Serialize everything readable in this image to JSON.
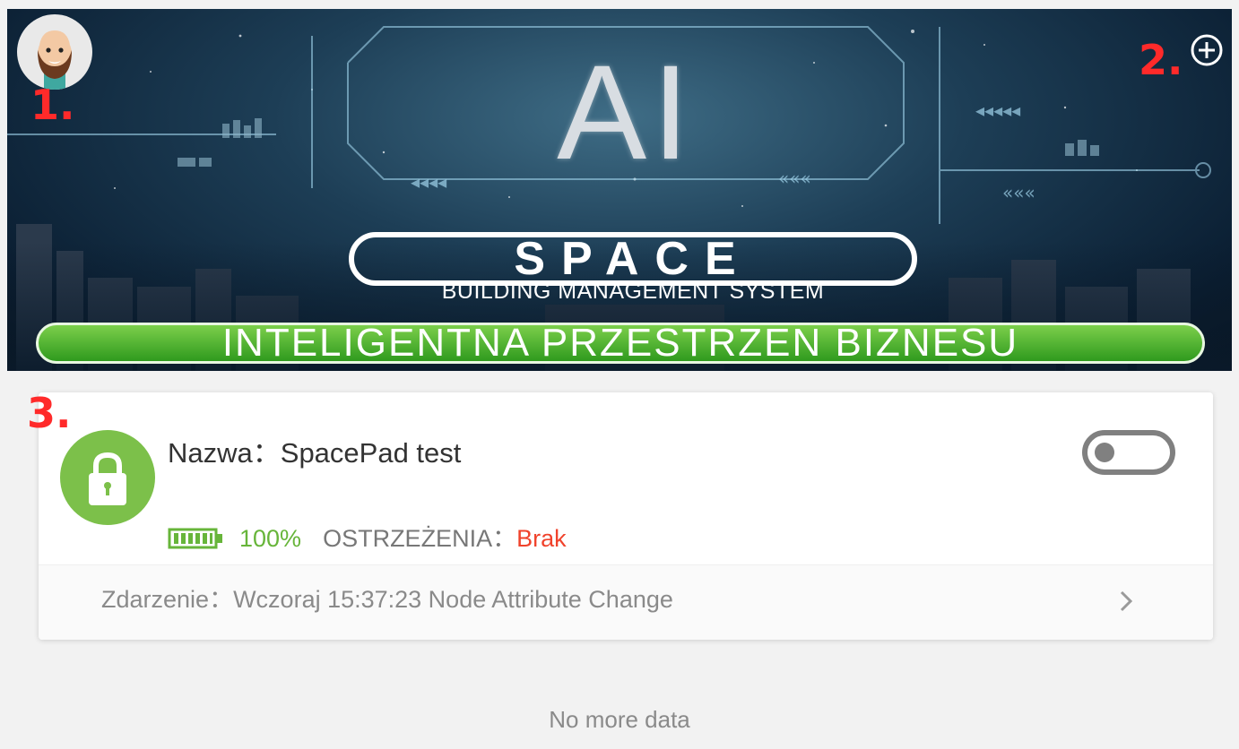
{
  "banner": {
    "ai_text": "AI",
    "logo_text": "SPACE",
    "subtitle": "BUILDING MANAGEMENT SYSTEM",
    "slogan": "INTELIGENTNA PRZESTRZEN BIZNESU"
  },
  "header": {
    "avatar_icon": "bearded-man-avatar-icon",
    "add_icon": "plus-circle-icon"
  },
  "markers": {
    "m1": "1.",
    "m2": "2.",
    "m3": "3."
  },
  "device": {
    "name_label": "Nazwa：",
    "name_value": "SpacePad test",
    "battery": "100%",
    "warnings_label": "OSTRZEŻENIA：",
    "warnings_value": "Brak",
    "event_label": "Zdarzenie：",
    "event_value": "Wczoraj 15:37:23 Node Attribute Change",
    "toggle_on": false,
    "lock_icon": "padlock-icon",
    "battery_icon": "battery-full-icon",
    "chevron_icon": "chevron-right-icon"
  },
  "footer": {
    "text": "No more data"
  },
  "colors": {
    "lock_green": "#7cc04a",
    "battery_green": "#67b53a",
    "warning_red": "#f0432c",
    "marker_red": "#ff2a2a",
    "slogan_green": "#2f9a1e"
  }
}
